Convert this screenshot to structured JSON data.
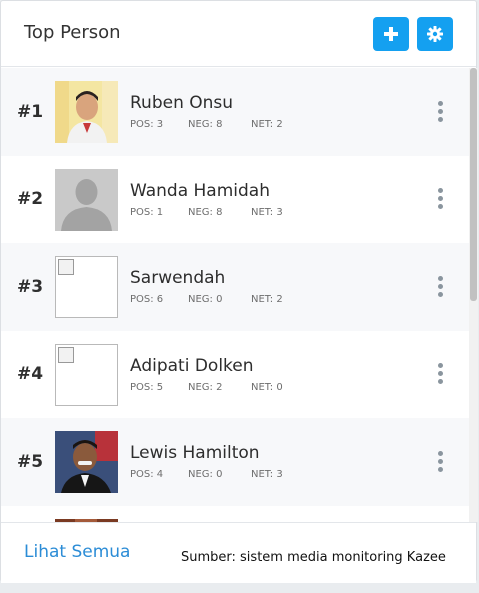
{
  "header": {
    "title": "Top Person",
    "add_icon": "plus-icon",
    "settings_icon": "gear-icon",
    "accent_color": "#14a0f0"
  },
  "people": [
    {
      "rank": "#1",
      "name": "Ruben Onsu",
      "pos": "POS: 3",
      "neg": "NEG: 8",
      "net": "NET: 2",
      "photo": "photo"
    },
    {
      "rank": "#2",
      "name": "Wanda Hamidah",
      "pos": "POS: 1",
      "neg": "NEG: 8",
      "net": "NET: 3",
      "photo": "silhouette"
    },
    {
      "rank": "#3",
      "name": "Sarwendah",
      "pos": "POS: 6",
      "neg": "NEG: 0",
      "net": "NET: 2",
      "photo": "broken"
    },
    {
      "rank": "#4",
      "name": "Adipati Dolken",
      "pos": "POS: 5",
      "neg": "NEG: 2",
      "net": "NET: 0",
      "photo": "broken"
    },
    {
      "rank": "#5",
      "name": "Lewis Hamilton",
      "pos": "POS: 4",
      "neg": "NEG: 0",
      "net": "NET: 3",
      "photo": "photo"
    }
  ],
  "footer": {
    "see_all": "Lihat Semua",
    "link_color": "#2b8cd6"
  },
  "source_note": "Sumber: sistem media monitoring Kazee"
}
